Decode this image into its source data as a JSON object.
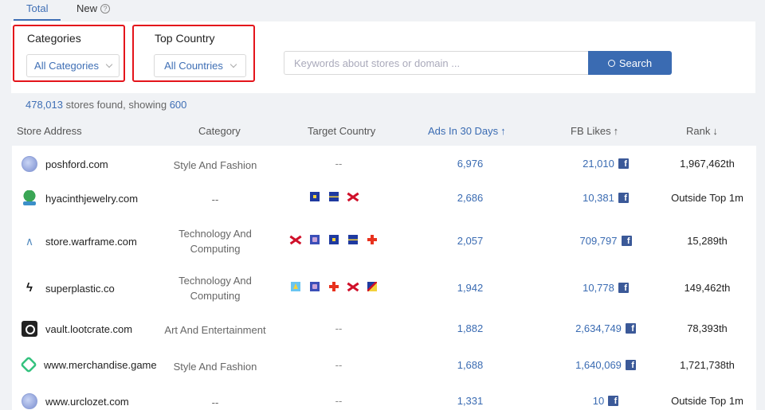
{
  "tabs": {
    "total": "Total",
    "new": "New",
    "help_glyph": "?"
  },
  "filters": {
    "categories": {
      "label": "Categories",
      "value": "All Categories"
    },
    "top_country": {
      "label": "Top Country",
      "value": "All Countries"
    },
    "search": {
      "placeholder": "Keywords about stores or domain ...",
      "button": "Search"
    }
  },
  "results": {
    "count": "478,013",
    "mid": " stores found, showing ",
    "showing": "600"
  },
  "columns": {
    "store": "Store Address",
    "category": "Category",
    "country": "Target Country",
    "ads": "Ads In 30 Days",
    "ads_arrow": "↑",
    "likes": "FB Likes",
    "likes_arrow": "↑",
    "rank": "Rank",
    "rank_arrow": "↓"
  },
  "fb_glyph": "f",
  "colors": {
    "accent": "#3a6bb2",
    "highlight_border": "#e4141b",
    "facebook": "#3b5998"
  },
  "rows": [
    {
      "store": "poshford.com",
      "logo": "globe-icon",
      "category": "Style And Fashion",
      "countries": "--",
      "flags": [],
      "ads": "6,976",
      "likes": "21,010",
      "rank": "1,967,462th"
    },
    {
      "store": "hyacinthjewelry.com",
      "logo": "tree-logo-icon",
      "category": "--",
      "countries": "",
      "flags": [
        "flag-blue",
        "flag-stripe",
        "flag-x"
      ],
      "ads": "2,686",
      "likes": "10,381",
      "rank": "Outside Top 1m"
    },
    {
      "store": "store.warframe.com",
      "logo": "chevron-logo-icon",
      "category": "Technology And Computing",
      "countries": "",
      "flags": [
        "flag-x",
        "flag-purple",
        "flag-blue",
        "flag-stripe",
        "flag-cross"
      ],
      "ads": "2,057",
      "likes": "709,797",
      "rank": "15,289th"
    },
    {
      "store": "superplastic.co",
      "logo": "bolt-logo-icon",
      "category": "Technology And Computing",
      "countries": "",
      "flags": [
        "flag-lc",
        "flag-purple",
        "flag-cross",
        "flag-x",
        "flag-multi"
      ],
      "ads": "1,942",
      "likes": "10,778",
      "rank": "149,462th"
    },
    {
      "store": "vault.lootcrate.com",
      "logo": "vault-logo-icon",
      "category": "Art And Entertainment",
      "countries": "--",
      "flags": [],
      "ads": "1,882",
      "likes": "2,634,749",
      "rank": "78,393th"
    },
    {
      "store": "www.merchandise.game",
      "logo": "hex-logo-icon",
      "category": "Style And Fashion",
      "countries": "--",
      "flags": [],
      "ads": "1,688",
      "likes": "1,640,069",
      "rank": "1,721,738th"
    },
    {
      "store": "www.urclozet.com",
      "logo": "globe-icon",
      "category": "--",
      "countries": "--",
      "flags": [],
      "ads": "1,331",
      "likes": "10",
      "rank": "Outside Top 1m"
    }
  ]
}
